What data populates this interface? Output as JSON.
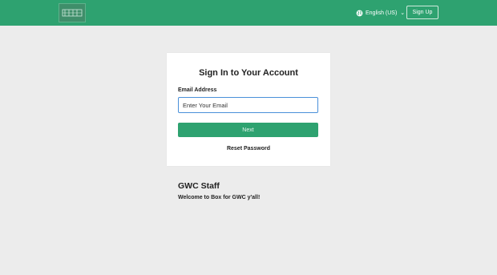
{
  "header": {
    "logo_icon": "box-logo-icon",
    "language_label": "English (US)",
    "language_icon": "globe-icon",
    "chevron_icon": "chevron-down-icon",
    "signup_label": "Sign Up",
    "bg_color": "#2ea270"
  },
  "login": {
    "title": "Sign In to Your Account",
    "email_label": "Email Address",
    "email_placeholder": "Enter Your Email",
    "email_value": "",
    "next_label": "Next",
    "reset_label": "Reset Password"
  },
  "info": {
    "title": "GWC Staff",
    "message": "Welcome to Box for GWC y'all!"
  }
}
